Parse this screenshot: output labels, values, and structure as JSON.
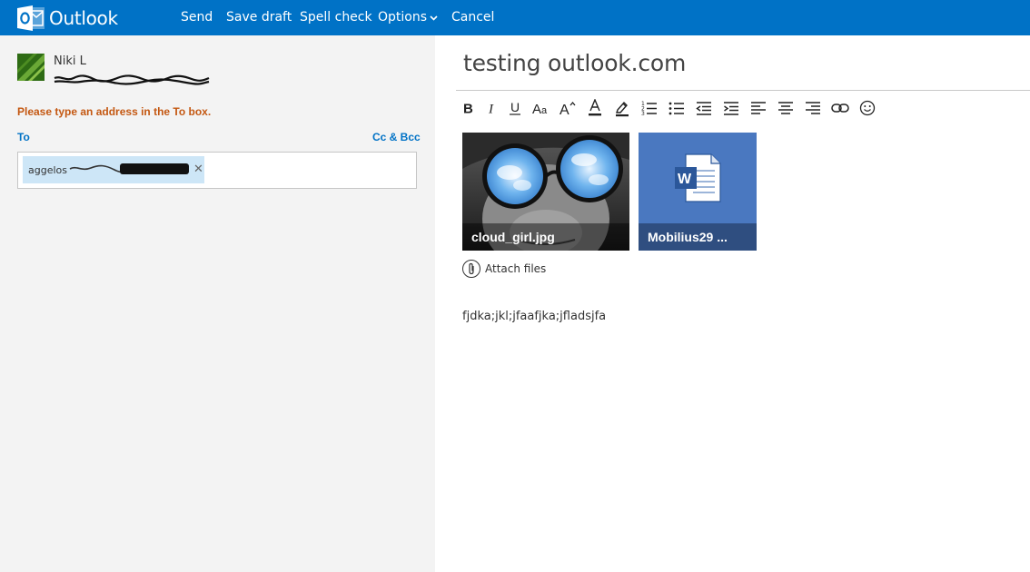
{
  "topbar": {
    "brand": "Outlook",
    "commands": {
      "send": "Send",
      "save_draft": "Save draft",
      "spell_check": "Spell check",
      "options": "Options",
      "cancel": "Cancel"
    },
    "color": "#0072c6"
  },
  "sender": {
    "name": "Niki L"
  },
  "compose": {
    "error": "Please type an address in the To box.",
    "to_label": "To",
    "cc_bcc": "Cc & Bcc",
    "recipient_chip": "aggelos"
  },
  "message": {
    "subject": "testing outlook.com",
    "body": "fjdka;jkl;jfaafjka;jfladsjfa"
  },
  "toolbar_icons": [
    "bold-icon",
    "italic-icon",
    "underline-icon",
    "font-size-icon",
    "grow-font-icon",
    "font-color-icon",
    "highlight-icon",
    "numbered-list-icon",
    "bulleted-list-icon",
    "decrease-indent-icon",
    "increase-indent-icon",
    "align-left-icon",
    "align-center-icon",
    "align-right-icon",
    "link-icon",
    "emoji-icon"
  ],
  "attachments": [
    {
      "name": "cloud_girl.jpg",
      "kind": "image"
    },
    {
      "name": "Mobilius29 ...",
      "kind": "word-document"
    }
  ],
  "attach_files_label": "Attach files",
  "colors": {
    "error": "#c45812",
    "link": "#0072c6",
    "chip": "#cde6f7",
    "word_tile": "#4a78c0"
  }
}
